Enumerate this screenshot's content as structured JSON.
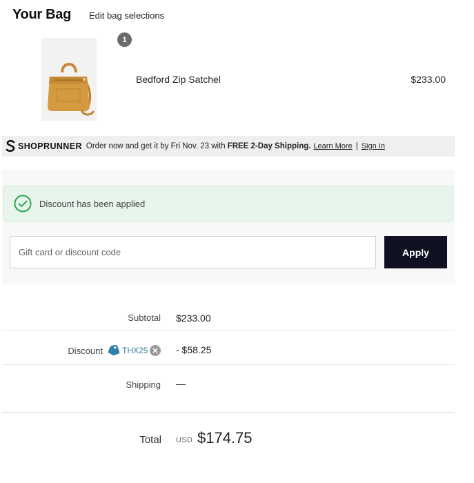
{
  "header": {
    "title": "Your Bag",
    "edit_link": "Edit bag selections"
  },
  "cart_items": [
    {
      "name": "Bedford Zip Satchel",
      "price": "$233.00",
      "quantity": "1",
      "image_icon": "satchel-bag-image"
    }
  ],
  "shoprunner": {
    "brand": "SHOPRUNNER",
    "message": "Order now and get it by Fri Nov. 23 with",
    "highlight": "FREE 2-Day Shipping.",
    "learn_more": "Learn More",
    "separator": "|",
    "sign_in": "Sign In"
  },
  "discount": {
    "success_message": "Discount has been applied",
    "input_placeholder": "Gift card or discount code",
    "input_value": "",
    "apply_label": "Apply"
  },
  "summary": {
    "subtotal_label": "Subtotal",
    "subtotal_value": "$233.00",
    "discount_label": "Discount",
    "discount_code": "THX25",
    "discount_value": "- $58.25",
    "shipping_label": "Shipping",
    "shipping_value": "—",
    "total_label": "Total",
    "currency": "USD",
    "total_value": "$174.75"
  },
  "colors": {
    "apply_button": "#0f1020",
    "success_banner_bg": "#e8f5ec",
    "success_check": "#2aa84a",
    "discount_code": "#2f7fa6",
    "shoprunner_bar": "#efefef"
  }
}
